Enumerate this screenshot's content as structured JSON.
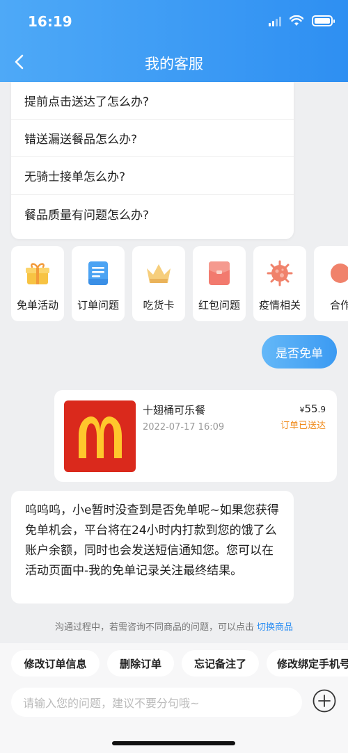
{
  "status_bar": {
    "time": "16:19"
  },
  "header": {
    "title": "我的客服"
  },
  "faq": [
    {
      "label": "提前点击送达了怎么办?"
    },
    {
      "label": "错送漏送餐品怎么办?"
    },
    {
      "label": "无骑士接单怎么办?"
    },
    {
      "label": "餐品质量有问题怎么办?"
    }
  ],
  "shortcuts": [
    {
      "label": "免单活动",
      "icon": "gift-icon"
    },
    {
      "label": "订单问题",
      "icon": "document-icon"
    },
    {
      "label": "吃货卡",
      "icon": "crown-icon"
    },
    {
      "label": "红包问题",
      "icon": "red-envelope-icon"
    },
    {
      "label": "疫情相关",
      "icon": "virus-icon"
    },
    {
      "label": "合作",
      "icon": "partner-icon"
    }
  ],
  "chat": {
    "user_message": "是否免单",
    "order": {
      "name": "十翅桶可乐餐",
      "time": "2022-07-17 16:09",
      "price_currency": "¥",
      "price_int": "55",
      "price_dec": ".9",
      "status": "订单已送达"
    },
    "bot_message": "呜呜呜，小e暂时没查到是否免单呢~如果您获得免单机会，平台将在24小时内打款到您的饿了么账户余额，同时也会发送短信通知您。您可以在活动页面中-我的免单记录关注最终结果。"
  },
  "hint": {
    "text": "沟通过程中，若需咨询不同商品的问题，可以点击",
    "link": "切换商品"
  },
  "quick_replies": [
    {
      "label": "修改订单信息"
    },
    {
      "label": "删除订单"
    },
    {
      "label": "忘记备注了"
    },
    {
      "label": "修改绑定手机号"
    }
  ],
  "input": {
    "placeholder": "请输入您的问题，建议不要分句哦~"
  },
  "colors": {
    "primary": "#2e8ff2",
    "accent_orange": "#f08b1b",
    "brand_red": "#da291c",
    "brand_yellow": "#ffc72c"
  }
}
